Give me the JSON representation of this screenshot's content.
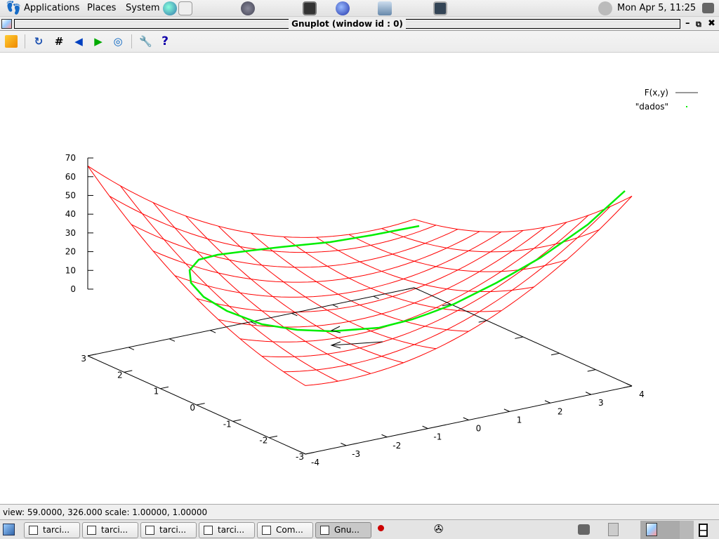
{
  "top_panel": {
    "menus": [
      "Applications",
      "Places",
      "System"
    ],
    "clock": "Mon Apr  5, 11:25",
    "icons": [
      "gnome-foot-icon",
      "web-browser-icon",
      "mail-clock-icon",
      "gimp-icon",
      "terminal-icon",
      "network-globe-icon",
      "cube-icon",
      "display-icon",
      "network-monitor-icon",
      "screenshot-icon"
    ]
  },
  "window": {
    "title": "Gnuplot (window id : 0)",
    "controls": [
      "minimize",
      "maximize",
      "close"
    ]
  },
  "toolbar": {
    "buttons": [
      "copy-to-clipboard",
      "replot",
      "grid",
      "previous-zoom",
      "next-zoom",
      "autoscale",
      "preferences",
      "help"
    ]
  },
  "chart_data": {
    "type": "surface",
    "legend": {
      "placement": "top-right",
      "entries": [
        {
          "label": "F(x,y)",
          "color": "#ff0000",
          "sample": "line"
        },
        {
          "label": "\"dados\"",
          "color": "#00ee00",
          "sample": "dot"
        }
      ]
    },
    "x_ticks": [
      "-4",
      "-3",
      "-2",
      "-1",
      "0",
      "1",
      "2",
      "3",
      "4"
    ],
    "y_ticks": [
      "3",
      "2",
      "1",
      "0",
      "-1",
      "-2",
      "-3"
    ],
    "z_ticks": [
      "70",
      "60",
      "50",
      "40",
      "30",
      "20",
      "10",
      "0"
    ],
    "x_range": [
      -4,
      4
    ],
    "y_range": [
      -3,
      3
    ],
    "z_range": [
      0,
      70
    ],
    "view": {
      "rot_x": 59,
      "rot_z": 326,
      "scale": 1,
      "scale_z": 1
    },
    "colors": {
      "surface": "#ff0000",
      "dados": "#00ee00",
      "axes": "#000000"
    }
  },
  "status_bar": {
    "text": "view: 59.0000,  326.000   scale: 1.00000,  1.00000"
  },
  "taskbar": {
    "tasks": [
      {
        "label": "tarci...",
        "active": false
      },
      {
        "label": "tarci...",
        "active": false
      },
      {
        "label": "tarci...",
        "active": false
      },
      {
        "label": "tarci...",
        "active": false
      },
      {
        "label": "Com...",
        "active": false
      },
      {
        "label": "Gnu...",
        "active": true
      }
    ]
  }
}
